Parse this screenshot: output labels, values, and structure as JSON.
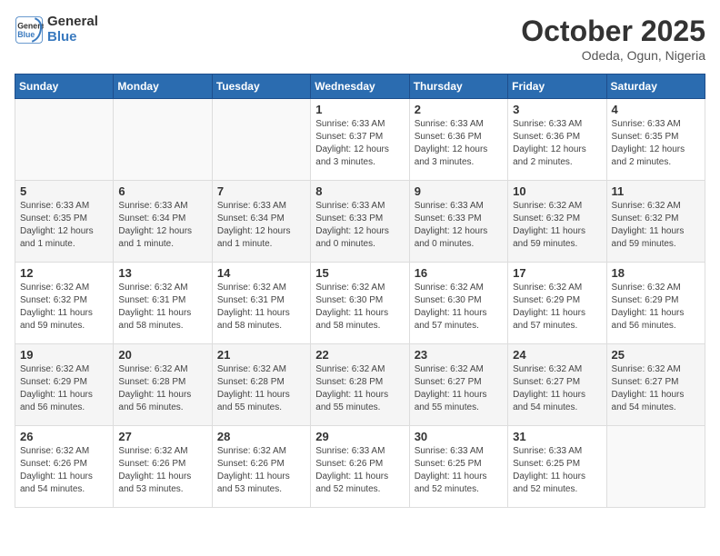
{
  "header": {
    "logo_line1": "General",
    "logo_line2": "Blue",
    "month": "October 2025",
    "location": "Odeda, Ogun, Nigeria"
  },
  "weekdays": [
    "Sunday",
    "Monday",
    "Tuesday",
    "Wednesday",
    "Thursday",
    "Friday",
    "Saturday"
  ],
  "weeks": [
    [
      {
        "day": "",
        "info": ""
      },
      {
        "day": "",
        "info": ""
      },
      {
        "day": "",
        "info": ""
      },
      {
        "day": "1",
        "info": "Sunrise: 6:33 AM\nSunset: 6:37 PM\nDaylight: 12 hours\nand 3 minutes."
      },
      {
        "day": "2",
        "info": "Sunrise: 6:33 AM\nSunset: 6:36 PM\nDaylight: 12 hours\nand 3 minutes."
      },
      {
        "day": "3",
        "info": "Sunrise: 6:33 AM\nSunset: 6:36 PM\nDaylight: 12 hours\nand 2 minutes."
      },
      {
        "day": "4",
        "info": "Sunrise: 6:33 AM\nSunset: 6:35 PM\nDaylight: 12 hours\nand 2 minutes."
      }
    ],
    [
      {
        "day": "5",
        "info": "Sunrise: 6:33 AM\nSunset: 6:35 PM\nDaylight: 12 hours\nand 1 minute."
      },
      {
        "day": "6",
        "info": "Sunrise: 6:33 AM\nSunset: 6:34 PM\nDaylight: 12 hours\nand 1 minute."
      },
      {
        "day": "7",
        "info": "Sunrise: 6:33 AM\nSunset: 6:34 PM\nDaylight: 12 hours\nand 1 minute."
      },
      {
        "day": "8",
        "info": "Sunrise: 6:33 AM\nSunset: 6:33 PM\nDaylight: 12 hours\nand 0 minutes."
      },
      {
        "day": "9",
        "info": "Sunrise: 6:33 AM\nSunset: 6:33 PM\nDaylight: 12 hours\nand 0 minutes."
      },
      {
        "day": "10",
        "info": "Sunrise: 6:32 AM\nSunset: 6:32 PM\nDaylight: 11 hours\nand 59 minutes."
      },
      {
        "day": "11",
        "info": "Sunrise: 6:32 AM\nSunset: 6:32 PM\nDaylight: 11 hours\nand 59 minutes."
      }
    ],
    [
      {
        "day": "12",
        "info": "Sunrise: 6:32 AM\nSunset: 6:32 PM\nDaylight: 11 hours\nand 59 minutes."
      },
      {
        "day": "13",
        "info": "Sunrise: 6:32 AM\nSunset: 6:31 PM\nDaylight: 11 hours\nand 58 minutes."
      },
      {
        "day": "14",
        "info": "Sunrise: 6:32 AM\nSunset: 6:31 PM\nDaylight: 11 hours\nand 58 minutes."
      },
      {
        "day": "15",
        "info": "Sunrise: 6:32 AM\nSunset: 6:30 PM\nDaylight: 11 hours\nand 58 minutes."
      },
      {
        "day": "16",
        "info": "Sunrise: 6:32 AM\nSunset: 6:30 PM\nDaylight: 11 hours\nand 57 minutes."
      },
      {
        "day": "17",
        "info": "Sunrise: 6:32 AM\nSunset: 6:29 PM\nDaylight: 11 hours\nand 57 minutes."
      },
      {
        "day": "18",
        "info": "Sunrise: 6:32 AM\nSunset: 6:29 PM\nDaylight: 11 hours\nand 56 minutes."
      }
    ],
    [
      {
        "day": "19",
        "info": "Sunrise: 6:32 AM\nSunset: 6:29 PM\nDaylight: 11 hours\nand 56 minutes."
      },
      {
        "day": "20",
        "info": "Sunrise: 6:32 AM\nSunset: 6:28 PM\nDaylight: 11 hours\nand 56 minutes."
      },
      {
        "day": "21",
        "info": "Sunrise: 6:32 AM\nSunset: 6:28 PM\nDaylight: 11 hours\nand 55 minutes."
      },
      {
        "day": "22",
        "info": "Sunrise: 6:32 AM\nSunset: 6:28 PM\nDaylight: 11 hours\nand 55 minutes."
      },
      {
        "day": "23",
        "info": "Sunrise: 6:32 AM\nSunset: 6:27 PM\nDaylight: 11 hours\nand 55 minutes."
      },
      {
        "day": "24",
        "info": "Sunrise: 6:32 AM\nSunset: 6:27 PM\nDaylight: 11 hours\nand 54 minutes."
      },
      {
        "day": "25",
        "info": "Sunrise: 6:32 AM\nSunset: 6:27 PM\nDaylight: 11 hours\nand 54 minutes."
      }
    ],
    [
      {
        "day": "26",
        "info": "Sunrise: 6:32 AM\nSunset: 6:26 PM\nDaylight: 11 hours\nand 54 minutes."
      },
      {
        "day": "27",
        "info": "Sunrise: 6:32 AM\nSunset: 6:26 PM\nDaylight: 11 hours\nand 53 minutes."
      },
      {
        "day": "28",
        "info": "Sunrise: 6:32 AM\nSunset: 6:26 PM\nDaylight: 11 hours\nand 53 minutes."
      },
      {
        "day": "29",
        "info": "Sunrise: 6:33 AM\nSunset: 6:26 PM\nDaylight: 11 hours\nand 52 minutes."
      },
      {
        "day": "30",
        "info": "Sunrise: 6:33 AM\nSunset: 6:25 PM\nDaylight: 11 hours\nand 52 minutes."
      },
      {
        "day": "31",
        "info": "Sunrise: 6:33 AM\nSunset: 6:25 PM\nDaylight: 11 hours\nand 52 minutes."
      },
      {
        "day": "",
        "info": ""
      }
    ]
  ]
}
